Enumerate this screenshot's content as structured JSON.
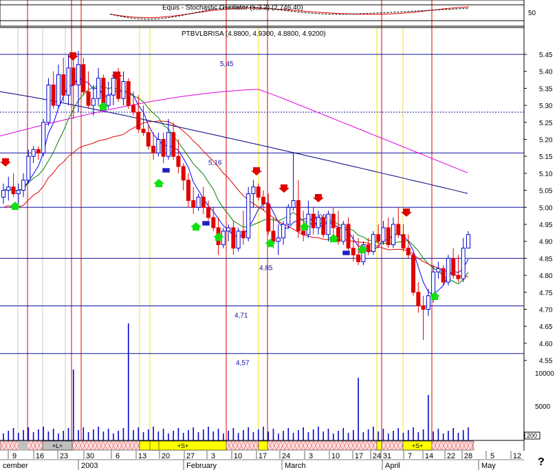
{
  "chart_data": {
    "type": "candlestick",
    "title": "PTBVLBRISA",
    "ohlc_label": "PTBVLBRISA (4.8800, 4.9300, 4.8800, 4.9200)",
    "indicator_title": "Equis - Stochastic Oscillator (5,3,3) (2,746.40)",
    "indicator_axis_label": "50",
    "price_axis": {
      "ticks": [
        "5.45",
        "5.40",
        "5.35",
        "5.30",
        "5.25",
        "5.20",
        "5.15",
        "5.10",
        "5.05",
        "5.00",
        "4.95",
        "4.90",
        "4.85",
        "4.80",
        "4.75",
        "4.70",
        "4.65",
        "4.60",
        "4.55"
      ],
      "ylim": [
        4.53,
        5.47
      ]
    },
    "volume_axis": {
      "ticks": [
        "10000",
        "5000"
      ]
    },
    "volume_box_label": "200",
    "horizontal_levels": [
      {
        "label": "5,45",
        "value": 5.45
      },
      {
        "label": "5,16",
        "value": 5.16
      },
      {
        "label": "5,00",
        "value": 5.0
      },
      {
        "label": "4,85",
        "value": 4.85
      },
      {
        "label": "4,71",
        "value": 4.71
      },
      {
        "label": "4,57",
        "value": 4.57
      }
    ],
    "dotted_level": 5.28,
    "date_ticks": [
      "9",
      "16",
      "23",
      "30",
      "6",
      "13",
      "20",
      "27",
      "3",
      "10",
      "17",
      "24",
      "3",
      "10",
      "17",
      "24",
      "31",
      "7",
      "14",
      "22",
      "28",
      "5",
      "12"
    ],
    "month_labels": [
      {
        "label": "cember"
      },
      {
        "label": "2003"
      },
      {
        "label": "February"
      },
      {
        "label": "March"
      },
      {
        "label": "April"
      },
      {
        "label": "May"
      }
    ],
    "signal_bar_labels": [
      "+L+",
      "+S+",
      "+S+"
    ],
    "corner_mark": "?",
    "ma_colors": {
      "blue": "#0000ff",
      "green": "#008000",
      "red": "#e00000",
      "navy": "#000080",
      "magenta": "#e000e0"
    },
    "candles": [
      {
        "o": 5.03,
        "h": 5.07,
        "l": 5.01,
        "c": 5.05
      },
      {
        "o": 5.05,
        "h": 5.09,
        "l": 5.02,
        "c": 5.06
      },
      {
        "o": 5.06,
        "h": 5.1,
        "l": 5.03,
        "c": 5.04
      },
      {
        "o": 5.04,
        "h": 5.07,
        "l": 5.01,
        "c": 5.05
      },
      {
        "o": 5.05,
        "h": 5.1,
        "l": 5.03,
        "c": 5.08
      },
      {
        "o": 5.08,
        "h": 5.17,
        "l": 5.07,
        "c": 5.15
      },
      {
        "o": 5.15,
        "h": 5.18,
        "l": 5.13,
        "c": 5.17
      },
      {
        "o": 5.17,
        "h": 5.18,
        "l": 5.14,
        "c": 5.16
      },
      {
        "o": 5.16,
        "h": 5.26,
        "l": 5.15,
        "c": 5.25
      },
      {
        "o": 5.25,
        "h": 5.38,
        "l": 5.24,
        "c": 5.36
      },
      {
        "o": 5.36,
        "h": 5.4,
        "l": 5.29,
        "c": 5.3
      },
      {
        "o": 5.3,
        "h": 5.42,
        "l": 5.29,
        "c": 5.39
      },
      {
        "o": 5.39,
        "h": 5.44,
        "l": 5.31,
        "c": 5.33
      },
      {
        "o": 5.33,
        "h": 5.45,
        "l": 5.3,
        "c": 5.41
      },
      {
        "o": 5.41,
        "h": 5.45,
        "l": 5.26,
        "c": 5.36
      },
      {
        "o": 5.36,
        "h": 5.46,
        "l": 5.28,
        "c": 5.42
      },
      {
        "o": 5.42,
        "h": 5.44,
        "l": 5.33,
        "c": 5.34
      },
      {
        "o": 5.34,
        "h": 5.4,
        "l": 5.29,
        "c": 5.3
      },
      {
        "o": 5.3,
        "h": 5.36,
        "l": 5.27,
        "c": 5.32
      },
      {
        "o": 5.32,
        "h": 5.41,
        "l": 5.3,
        "c": 5.38
      },
      {
        "o": 5.38,
        "h": 5.39,
        "l": 5.28,
        "c": 5.3
      },
      {
        "o": 5.3,
        "h": 5.37,
        "l": 5.29,
        "c": 5.33
      },
      {
        "o": 5.33,
        "h": 5.4,
        "l": 5.3,
        "c": 5.38
      },
      {
        "o": 5.38,
        "h": 5.41,
        "l": 5.31,
        "c": 5.32
      },
      {
        "o": 5.32,
        "h": 5.4,
        "l": 5.3,
        "c": 5.37
      },
      {
        "o": 5.37,
        "h": 5.38,
        "l": 5.29,
        "c": 5.3
      },
      {
        "o": 5.3,
        "h": 5.34,
        "l": 5.27,
        "c": 5.28
      },
      {
        "o": 5.28,
        "h": 5.33,
        "l": 5.22,
        "c": 5.23
      },
      {
        "o": 5.23,
        "h": 5.3,
        "l": 5.21,
        "c": 5.22
      },
      {
        "o": 5.22,
        "h": 5.24,
        "l": 5.17,
        "c": 5.18
      },
      {
        "o": 5.18,
        "h": 5.22,
        "l": 5.14,
        "c": 5.16
      },
      {
        "o": 5.16,
        "h": 5.22,
        "l": 5.15,
        "c": 5.2
      },
      {
        "o": 5.2,
        "h": 5.22,
        "l": 5.13,
        "c": 5.15
      },
      {
        "o": 5.15,
        "h": 5.26,
        "l": 5.14,
        "c": 5.22
      },
      {
        "o": 5.22,
        "h": 5.25,
        "l": 5.14,
        "c": 5.15
      },
      {
        "o": 5.15,
        "h": 5.2,
        "l": 5.1,
        "c": 5.12
      },
      {
        "o": 5.12,
        "h": 5.13,
        "l": 5.05,
        "c": 5.08
      },
      {
        "o": 5.08,
        "h": 5.1,
        "l": 5.0,
        "c": 5.02
      },
      {
        "o": 5.02,
        "h": 5.06,
        "l": 4.98,
        "c": 5.0
      },
      {
        "o": 5.0,
        "h": 5.04,
        "l": 4.99,
        "c": 5.03
      },
      {
        "o": 5.03,
        "h": 5.06,
        "l": 4.98,
        "c": 5.0
      },
      {
        "o": 5.0,
        "h": 5.02,
        "l": 4.96,
        "c": 4.97
      },
      {
        "o": 4.97,
        "h": 5.0,
        "l": 4.93,
        "c": 4.94
      },
      {
        "o": 4.94,
        "h": 4.97,
        "l": 4.86,
        "c": 4.89
      },
      {
        "o": 4.89,
        "h": 4.94,
        "l": 4.88,
        "c": 4.93
      },
      {
        "o": 4.93,
        "h": 4.95,
        "l": 4.9,
        "c": 4.94
      },
      {
        "o": 4.94,
        "h": 4.96,
        "l": 4.86,
        "c": 4.88
      },
      {
        "o": 4.88,
        "h": 4.94,
        "l": 4.87,
        "c": 4.93
      },
      {
        "o": 4.93,
        "h": 4.99,
        "l": 4.89,
        "c": 4.91
      },
      {
        "o": 4.91,
        "h": 5.06,
        "l": 4.9,
        "c": 5.04
      },
      {
        "o": 5.04,
        "h": 5.08,
        "l": 5.0,
        "c": 5.06
      },
      {
        "o": 5.06,
        "h": 5.07,
        "l": 5.02,
        "c": 5.03
      },
      {
        "o": 5.03,
        "h": 5.05,
        "l": 4.99,
        "c": 5.01
      },
      {
        "o": 5.01,
        "h": 5.04,
        "l": 4.92,
        "c": 4.93
      },
      {
        "o": 4.93,
        "h": 4.97,
        "l": 4.88,
        "c": 4.9
      },
      {
        "o": 4.9,
        "h": 4.95,
        "l": 4.86,
        "c": 4.91
      },
      {
        "o": 4.91,
        "h": 4.96,
        "l": 4.89,
        "c": 4.95
      },
      {
        "o": 4.95,
        "h": 5.01,
        "l": 4.94,
        "c": 5.0
      },
      {
        "o": 5.0,
        "h": 5.16,
        "l": 4.99,
        "c": 5.02
      },
      {
        "o": 5.02,
        "h": 5.08,
        "l": 4.91,
        "c": 4.93
      },
      {
        "o": 4.93,
        "h": 4.99,
        "l": 4.9,
        "c": 4.92
      },
      {
        "o": 4.92,
        "h": 5.02,
        "l": 4.91,
        "c": 4.98
      },
      {
        "o": 4.98,
        "h": 5.0,
        "l": 4.92,
        "c": 4.94
      },
      {
        "o": 4.94,
        "h": 4.99,
        "l": 4.92,
        "c": 4.97
      },
      {
        "o": 4.97,
        "h": 4.98,
        "l": 4.91,
        "c": 4.92
      },
      {
        "o": 4.92,
        "h": 4.99,
        "l": 4.9,
        "c": 4.98
      },
      {
        "o": 4.98,
        "h": 5.0,
        "l": 4.92,
        "c": 4.94
      },
      {
        "o": 4.94,
        "h": 4.99,
        "l": 4.89,
        "c": 4.9
      },
      {
        "o": 4.9,
        "h": 4.96,
        "l": 4.89,
        "c": 4.95
      },
      {
        "o": 4.95,
        "h": 4.97,
        "l": 4.87,
        "c": 4.88
      },
      {
        "o": 4.88,
        "h": 4.92,
        "l": 4.84,
        "c": 4.86
      },
      {
        "o": 4.86,
        "h": 4.91,
        "l": 4.83,
        "c": 4.84
      },
      {
        "o": 4.84,
        "h": 4.9,
        "l": 4.83,
        "c": 4.89
      },
      {
        "o": 4.89,
        "h": 4.91,
        "l": 4.86,
        "c": 4.87
      },
      {
        "o": 4.87,
        "h": 4.93,
        "l": 4.86,
        "c": 4.92
      },
      {
        "o": 4.92,
        "h": 4.95,
        "l": 4.88,
        "c": 4.9
      },
      {
        "o": 4.9,
        "h": 4.96,
        "l": 4.89,
        "c": 4.94
      },
      {
        "o": 4.94,
        "h": 4.97,
        "l": 4.88,
        "c": 4.89
      },
      {
        "o": 4.89,
        "h": 4.97,
        "l": 4.88,
        "c": 4.95
      },
      {
        "o": 4.95,
        "h": 5.0,
        "l": 4.91,
        "c": 4.92
      },
      {
        "o": 4.92,
        "h": 4.95,
        "l": 4.87,
        "c": 4.88
      },
      {
        "o": 4.88,
        "h": 4.92,
        "l": 4.85,
        "c": 4.86
      },
      {
        "o": 4.86,
        "h": 4.87,
        "l": 4.74,
        "c": 4.75
      },
      {
        "o": 4.75,
        "h": 4.78,
        "l": 4.69,
        "c": 4.71
      },
      {
        "o": 4.71,
        "h": 4.74,
        "l": 4.61,
        "c": 4.7
      },
      {
        "o": 4.7,
        "h": 4.76,
        "l": 4.68,
        "c": 4.74
      },
      {
        "o": 4.74,
        "h": 4.83,
        "l": 4.72,
        "c": 4.81
      },
      {
        "o": 4.81,
        "h": 4.84,
        "l": 4.79,
        "c": 4.82
      },
      {
        "o": 4.82,
        "h": 4.83,
        "l": 4.77,
        "c": 4.78
      },
      {
        "o": 4.78,
        "h": 4.86,
        "l": 4.77,
        "c": 4.85
      },
      {
        "o": 4.85,
        "h": 4.88,
        "l": 4.79,
        "c": 4.8
      },
      {
        "o": 4.8,
        "h": 4.86,
        "l": 4.78,
        "c": 4.79
      },
      {
        "o": 4.79,
        "h": 4.91,
        "l": 4.78,
        "c": 4.88
      },
      {
        "o": 4.88,
        "h": 4.93,
        "l": 4.88,
        "c": 4.92
      }
    ]
  }
}
